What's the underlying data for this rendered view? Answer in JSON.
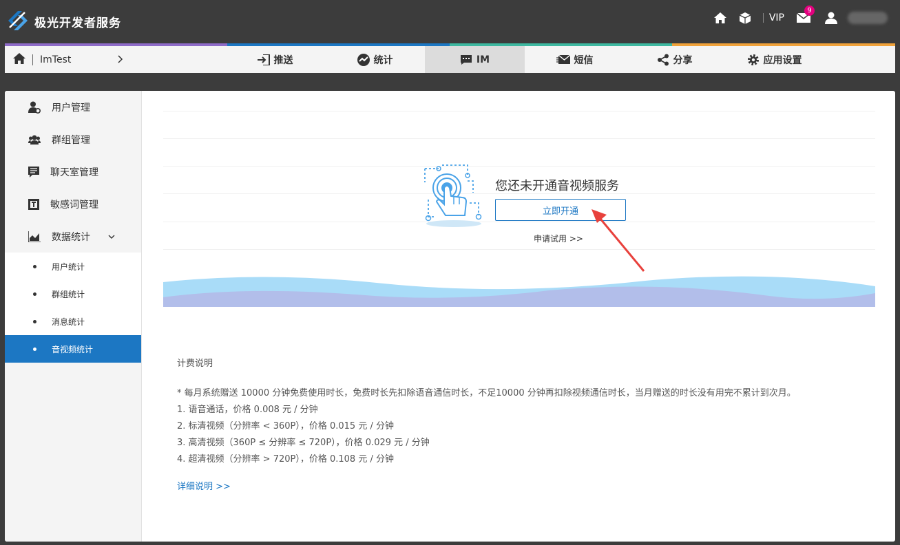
{
  "brand": {
    "name": "极光开发者服务"
  },
  "topbar": {
    "vip_label": "VIP",
    "mail_badge": "9"
  },
  "nav": {
    "app_name": "ImTest",
    "stripe_colors": [
      "#8e6bc8",
      "#1c77c3",
      "#3eb8a0",
      "#f0a23a"
    ],
    "tabs": [
      {
        "label": "推送",
        "icon": "push-icon"
      },
      {
        "label": "统计",
        "icon": "stats-icon"
      },
      {
        "label": "IM",
        "icon": "chat-icon",
        "active": true
      },
      {
        "label": "短信",
        "icon": "sms-icon"
      },
      {
        "label": "分享",
        "icon": "share-icon"
      },
      {
        "label": "应用设置",
        "icon": "gear-icon"
      }
    ]
  },
  "sidebar": {
    "items": [
      {
        "label": "用户管理",
        "icon": "user-manage-icon"
      },
      {
        "label": "群组管理",
        "icon": "group-icon"
      },
      {
        "label": "聊天室管理",
        "icon": "chatroom-icon"
      },
      {
        "label": "敏感词管理",
        "icon": "sensitive-word-icon"
      },
      {
        "label": "数据统计",
        "icon": "chart-icon",
        "expanded": true
      }
    ],
    "sub_items": [
      {
        "label": "用户统计"
      },
      {
        "label": "群组统计"
      },
      {
        "label": "消息统计"
      },
      {
        "label": "音视频统计",
        "active": true
      }
    ]
  },
  "promo": {
    "title": "您还未开通音视频服务",
    "open_button": "立即开通",
    "trial_link": "申请试用 >>"
  },
  "fees": {
    "title": "计费说明",
    "lines": [
      "* 每月系统赠送 10000 分钟免费使用时长，免费时长先扣除语音通信时长，不足10000 分钟再扣除视频通信时长，当月赠送的时长没有用完不累计到次月。",
      "1. 语音通话，价格 0.008 元 / 分钟",
      "2. 标清视频（分辨率 < 360P），价格 0.015 元 / 分钟",
      "3. 高清视频（360P ≤ 分辨率 ≤ 720P），价格 0.029 元 / 分钟",
      "4. 超清视频（分辨率 > 720P），价格 0.108 元 / 分钟"
    ],
    "detail_link": "详细说明 >>"
  },
  "colors": {
    "accent": "#1c77c3",
    "arrow": "#e8413c"
  }
}
